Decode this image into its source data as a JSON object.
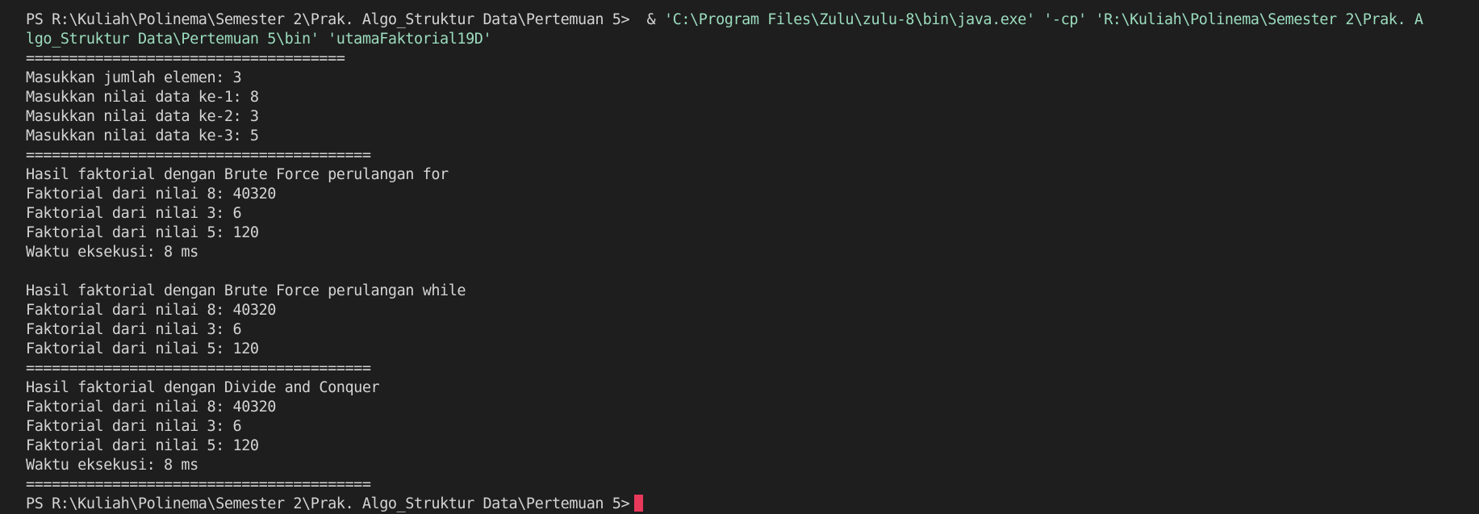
{
  "terminal": {
    "prompt": "PS R:\\Kuliah\\Polinema\\Semester 2\\Prak. Algo_Struktur Data\\Pertemuan 5>",
    "command": {
      "amp": " & ",
      "java_path": "'C:\\Program Files\\Zulu\\zulu-8\\bin\\java.exe'",
      "cp_flag": "'-cp'",
      "cp_part1": "'R:\\Kuliah\\Polinema\\Semester 2\\Prak. A",
      "cp_part2": "lgo_Struktur Data\\Pertemuan 5\\bin'",
      "main_class": "'utamaFaktorial19D'"
    },
    "output": [
      "=====================================",
      "Masukkan jumlah elemen: 3",
      "Masukkan nilai data ke-1: 8",
      "Masukkan nilai data ke-2: 3",
      "Masukkan nilai data ke-3: 5",
      "========================================",
      "Hasil faktorial dengan Brute Force perulangan for",
      "Faktorial dari nilai 8: 40320",
      "Faktorial dari nilai 3: 6",
      "Faktorial dari nilai 5: 120",
      "Waktu eksekusi: 8 ms",
      "",
      "Hasil faktorial dengan Brute Force perulangan while",
      "Faktorial dari nilai 8: 40320",
      "Faktorial dari nilai 3: 6",
      "Faktorial dari nilai 5: 120",
      "========================================",
      "Hasil faktorial dengan Divide and Conquer",
      "Faktorial dari nilai 8: 40320",
      "Faktorial dari nilai 3: 6",
      "Faktorial dari nilai 5: 120",
      "Waktu eksekusi: 8 ms",
      "========================================"
    ],
    "final_prompt": "PS R:\\Kuliah\\Polinema\\Semester 2\\Prak. Algo_Struktur Data\\Pertemuan 5>"
  },
  "colors": {
    "background": "#1e1e1e",
    "text": "#d4d4d4",
    "argument": "#9cdcbe",
    "cursor": "#e8395b"
  }
}
